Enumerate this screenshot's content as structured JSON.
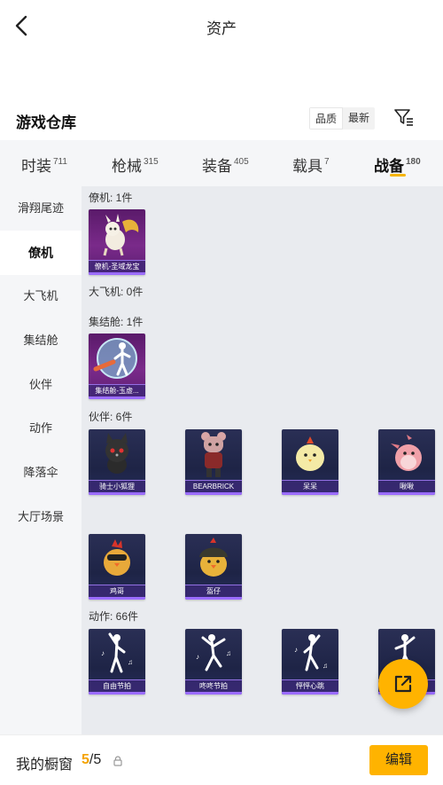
{
  "header": {
    "title": "资产"
  },
  "warehouse": {
    "title": "游戏仓库",
    "sort_options": [
      "品质",
      "最新"
    ],
    "sort_selected": "品质"
  },
  "tabs": [
    {
      "label": "时装",
      "count": "711"
    },
    {
      "label": "枪械",
      "count": "315"
    },
    {
      "label": "装备",
      "count": "405"
    },
    {
      "label": "载具",
      "count": "7"
    },
    {
      "label": "战备",
      "count": "180",
      "active": true
    }
  ],
  "sidebar": {
    "items": [
      "滑翔尾迹",
      "僚机",
      "大飞机",
      "集结舱",
      "伙伴",
      "动作",
      "降落伞",
      "大厅场景"
    ],
    "active": "僚机"
  },
  "groups": [
    {
      "label": "僚机: 1件",
      "items": [
        {
          "name": "僚机-圣域龙宝",
          "icon": "dragon-icon"
        }
      ]
    },
    {
      "label": "大飞机: 0件",
      "items": []
    },
    {
      "label": "集结舱: 1件",
      "items": [
        {
          "name": "集结舱-玉虚...",
          "icon": "capsule-icon"
        }
      ]
    },
    {
      "label": "伙伴: 6件",
      "items": [
        {
          "name": "骑士小狐狸",
          "icon": "black-fox-icon"
        },
        {
          "name": "BEARBRICK",
          "icon": "bearbrick-icon"
        },
        {
          "name": "呆呆",
          "icon": "chick-icon"
        },
        {
          "name": "啾啾",
          "icon": "pink-bird-icon"
        },
        {
          "name": "鸡哥",
          "icon": "rooster-icon"
        },
        {
          "name": "盔仔",
          "icon": "helmet-chick-icon"
        }
      ]
    },
    {
      "label": "动作: 66件",
      "items": [
        {
          "name": "自由节拍",
          "icon": "dance-icon"
        },
        {
          "name": "咚咚节拍",
          "icon": "dance-icon"
        },
        {
          "name": "怦怦心跳",
          "icon": "dance-icon"
        },
        {
          "name": "",
          "icon": "dance-icon"
        }
      ]
    }
  ],
  "bottom": {
    "showcase_label": "我的橱窗",
    "showcase_current": "5",
    "showcase_total": "/5",
    "edit_label": "编辑"
  },
  "colors": {
    "accent": "#ffb300",
    "rarity_purple": "#9b6cff"
  }
}
